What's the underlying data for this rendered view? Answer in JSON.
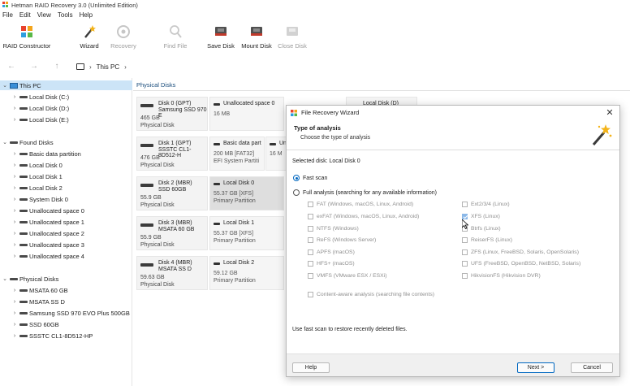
{
  "window": {
    "title": "Hetman RAID Recovery 3.0 (Unlimited Edition)"
  },
  "menu": [
    "File",
    "Edit",
    "View",
    "Tools",
    "Help"
  ],
  "toolbar": [
    {
      "label": "RAID Constructor",
      "icon": "raid-constructor-icon",
      "enabled": true
    },
    {
      "label": "Wizard",
      "icon": "wizard-icon",
      "enabled": true
    },
    {
      "label": "Recovery",
      "icon": "recovery-icon",
      "enabled": false
    },
    {
      "label": "Find File",
      "icon": "find-file-icon",
      "enabled": false
    },
    {
      "label": "Save Disk",
      "icon": "save-disk-icon",
      "enabled": true
    },
    {
      "label": "Mount Disk",
      "icon": "mount-disk-icon",
      "enabled": true
    },
    {
      "label": "Close Disk",
      "icon": "close-disk-icon",
      "enabled": false
    }
  ],
  "nav": {
    "crumb": "This PC"
  },
  "tree": {
    "this_pc": "This PC",
    "this_pc_items": [
      "Local Disk (C:)",
      "Local Disk (D:)",
      "Local Disk (E:)"
    ],
    "found_disks": "Found Disks",
    "found_items": [
      "Basic data partition",
      "Local Disk 0",
      "Local Disk 1",
      "Local Disk 2",
      "System Disk 0",
      "Unallocated space 0",
      "Unallocated space 1",
      "Unallocated space 2",
      "Unallocated space 3",
      "Unallocated space 4"
    ],
    "physical_disks": "Physical Disks",
    "physical_items": [
      "MSATA 60 GB",
      "MSATA SS D",
      "Samsung SSD 970 EVO Plus 500GB",
      "SSD 60GB",
      "SSSTC CL1-8D512-HP"
    ]
  },
  "main": {
    "header": "Physical Disks",
    "disks": [
      {
        "name": "Disk 0 (GPT)",
        "model": "Samsung SSD 970 E",
        "size": "465 GB",
        "type": "Physical Disk",
        "parts": [
          {
            "name": "Unallocated space 0",
            "size": "16 MB",
            "type": ""
          },
          {
            "name": "Local Disk (D)",
            "size": "",
            "type": ""
          }
        ]
      },
      {
        "name": "Disk 1 (GPT)",
        "model": "SSSTC CL1-8D512-H",
        "size": "476 GB",
        "type": "Physical Disk",
        "parts": [
          {
            "name": "Basic data part",
            "size": "200 MB [FAT32]",
            "type": "EFI System Partiti"
          },
          {
            "name": "Un",
            "size": "16 M",
            "type": ""
          }
        ]
      },
      {
        "name": "Disk 2 (MBR)",
        "model": "SSD 60GB",
        "size": "55.9 GB",
        "type": "Physical Disk",
        "parts": [
          {
            "name": "Local Disk 0",
            "size": "55.37 GB [XFS]",
            "type": "Primary Partition"
          }
        ]
      },
      {
        "name": "Disk 3 (MBR)",
        "model": "MSATA 60 GB",
        "size": "55.9 GB",
        "type": "Physical Disk",
        "parts": [
          {
            "name": "Local Disk 1",
            "size": "55.37 GB [XFS]",
            "type": "Primary Partition"
          }
        ]
      },
      {
        "name": "Disk 4 (MBR)",
        "model": "MSATA SS D",
        "size": "59.63 GB",
        "type": "Physical Disk",
        "parts": [
          {
            "name": "Local Disk 2",
            "size": "59.12 GB",
            "type": "Primary Partition"
          }
        ]
      }
    ]
  },
  "dialog": {
    "title": "File Recovery Wizard",
    "heading": "Type of analysis",
    "subheading": "Choose the type of analysis",
    "selected_disk": "Selected disk: Local Disk 0",
    "fast_scan": "Fast scan",
    "full_analysis": "Full analysis (searching for any available information)",
    "fs_left": [
      {
        "label": "FAT (Windows, macOS, Linux, Android)",
        "checked": false
      },
      {
        "label": "exFAT (Windows, macOS, Linux, Android)",
        "checked": false
      },
      {
        "label": "NTFS (Windows)",
        "checked": false
      },
      {
        "label": "ReFS (Windows Server)",
        "checked": false
      },
      {
        "label": "APFS (macOS)",
        "checked": false
      },
      {
        "label": "HFS+ (macOS)",
        "checked": false
      },
      {
        "label": "VMFS (VMware ESX / ESXi)",
        "checked": false
      }
    ],
    "fs_right": [
      {
        "label": "Ext2/3/4 (Linux)",
        "checked": false
      },
      {
        "label": "XFS (Linux)",
        "checked": true
      },
      {
        "label": "Btrfs (Linux)",
        "checked": false
      },
      {
        "label": "ReiserFS (Linux)",
        "checked": false
      },
      {
        "label": "ZFS (Linux, FreeBSD, Solaris, OpenSolaris)",
        "checked": false
      },
      {
        "label": "UFS (FreeBSD, OpenBSD, NetBSD, Solaris)",
        "checked": false
      },
      {
        "label": "HikvisionFS (Hikvision DVR)",
        "checked": false
      }
    ],
    "content_aware": "Content-aware analysis (searching file contents)",
    "hint": "Use fast scan to restore recently deleted files.",
    "help": "Help",
    "next": "Next >",
    "cancel": "Cancel"
  }
}
